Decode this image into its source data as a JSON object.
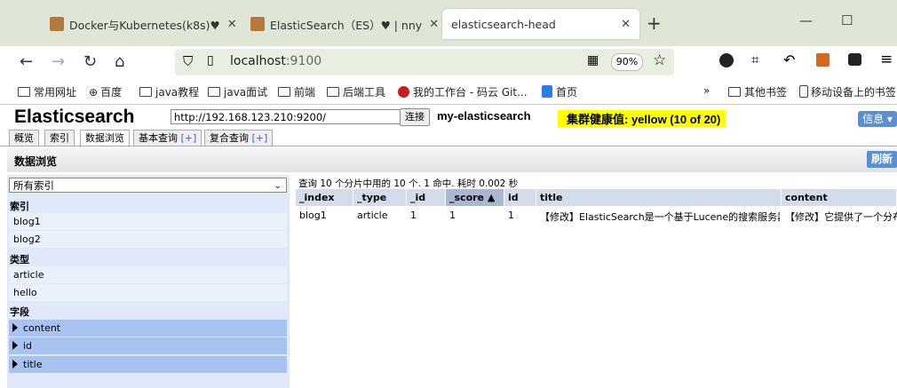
{
  "browser": {
    "tabs": [
      {
        "title": "Docker与Kubernetes(k8s)♥"
      },
      {
        "title": "ElasticSearch（ES）♥ | nny"
      },
      {
        "title": "elasticsearch-head"
      }
    ],
    "url_host": "localhost",
    "url_port": ":9100",
    "zoom": "90%",
    "bookmarks": [
      "常用网址",
      "百度",
      "java教程",
      "java面试",
      "前端",
      "后端工具",
      "我的工作台 - 码云 Git...",
      "首页",
      "其他书签",
      "移动设备上的书签"
    ]
  },
  "app": {
    "brand": "Elasticsearch",
    "host_value": "http://192.168.123.210:9200/",
    "connect_label": "连接",
    "cluster_name": "my-elasticsearch",
    "health": "集群健康值: yellow (10 of 20)",
    "info_label": "信息 ▾",
    "tabs": [
      {
        "label": "概览"
      },
      {
        "label": "索引"
      },
      {
        "label": "数据浏览"
      },
      {
        "label": "基本查询",
        "plus": "[+]"
      },
      {
        "label": "复合查询",
        "plus": "[+]"
      }
    ],
    "section_title": "数据浏览",
    "refresh_label": "刷新"
  },
  "sidebar": {
    "index_select": "所有索引",
    "indices_header": "索引",
    "indices": [
      "blog1",
      "blog2"
    ],
    "types_header": "类型",
    "types": [
      "article",
      "hello"
    ],
    "fields_header": "字段",
    "fields": [
      "content",
      "id",
      "title"
    ]
  },
  "results": {
    "meta": "查询 10 个分片中用的 10 个. 1 命中. 耗时 0.002 秒",
    "columns": [
      "_index",
      "_type",
      "_id",
      "_score ▲",
      "id",
      "title",
      "content"
    ],
    "rows": [
      [
        "blog1",
        "article",
        "1",
        "1",
        "1",
        "【修改】ElasticSearch是一个基于Lucene的搜索服务器",
        "【修改】它提供了一个分布"
      ]
    ]
  }
}
